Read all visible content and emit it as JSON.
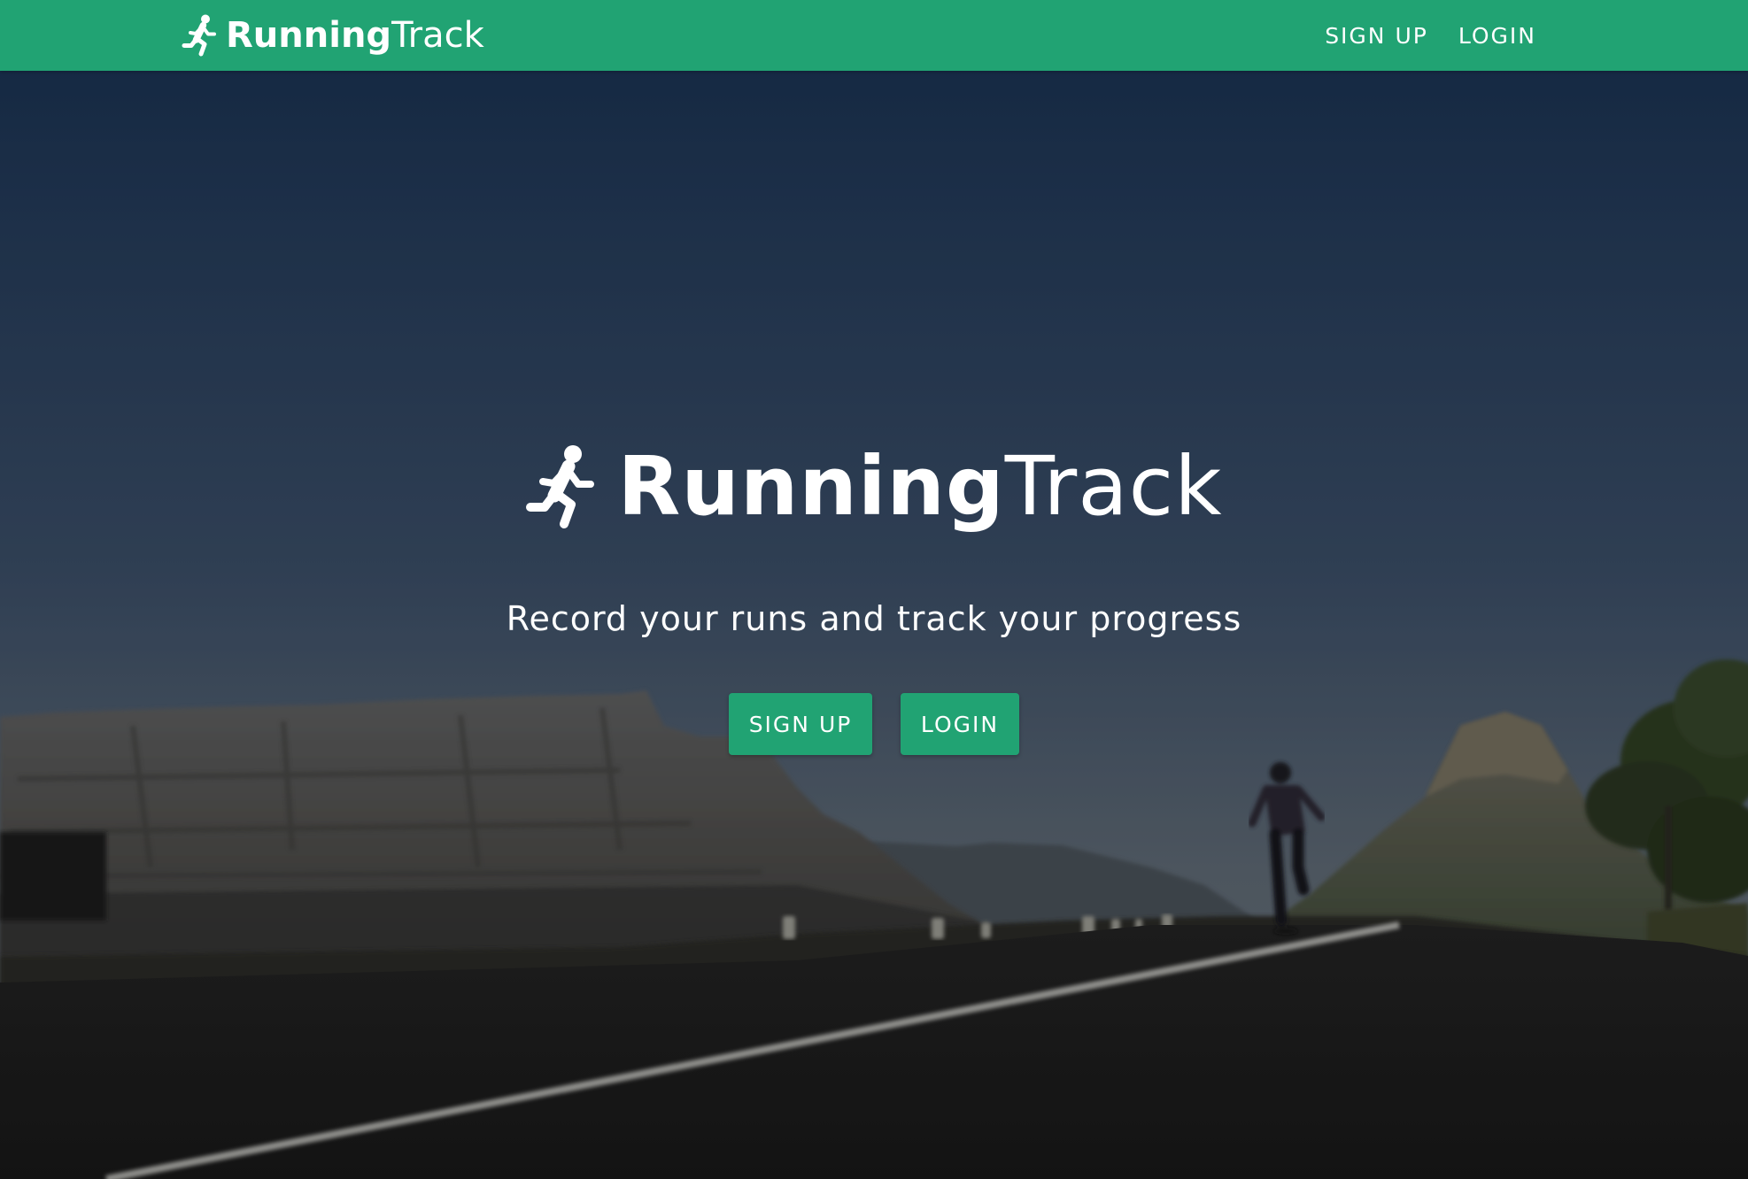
{
  "colors": {
    "brand_green": "#21a373",
    "text_white": "#ffffff",
    "sky_top": "#1b3353",
    "sky_bottom": "#5d6873",
    "road": "#1b1b1c"
  },
  "navbar": {
    "brand": {
      "icon": "runner-icon",
      "name_bold": "Running",
      "name_light": "Track"
    },
    "links": {
      "signup": "SIGN UP",
      "login": "LOGIN"
    }
  },
  "hero": {
    "background": "runner-on-road-mountain-photo",
    "logo": {
      "icon": "runner-icon",
      "name_bold": "Running",
      "name_light": "Track"
    },
    "tagline": "Record your runs and track your progress",
    "buttons": {
      "signup": "SIGN UP",
      "login": "LOGIN"
    }
  }
}
